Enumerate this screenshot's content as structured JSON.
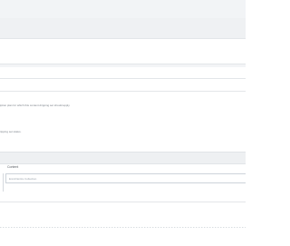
{
  "settings": {
    "plan_help_text": "iption plan for which this content dripping set should apply.",
    "status_help_text": "ripping set status."
  },
  "content_section": {
    "label": "Content",
    "input_placeholder": "Enroll Entire Collection"
  }
}
